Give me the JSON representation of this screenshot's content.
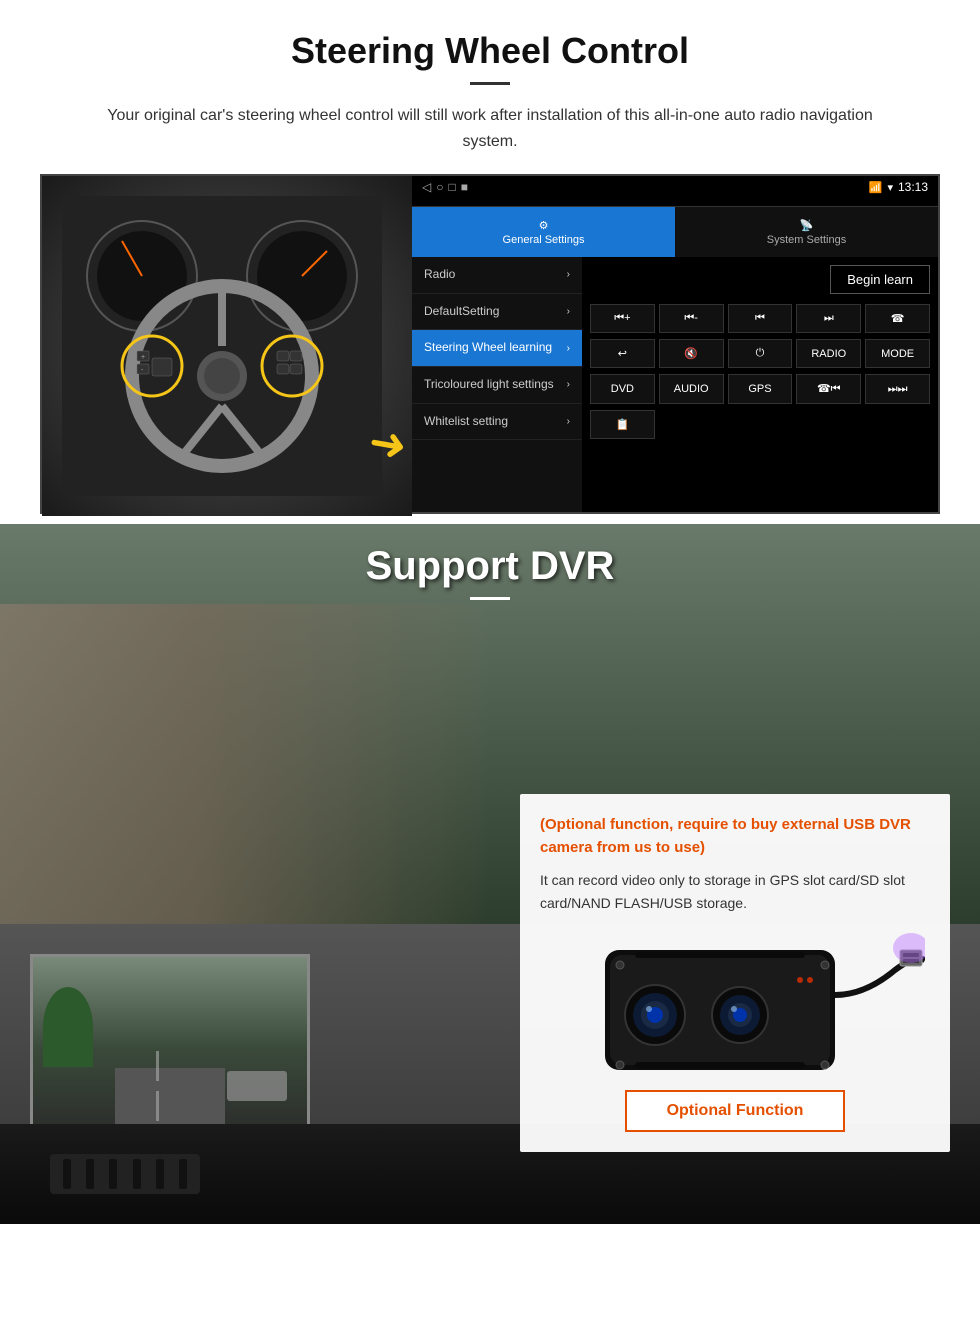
{
  "page": {
    "steering_section": {
      "title": "Steering Wheel Control",
      "description": "Your original car's steering wheel control will still work after installation of this all-in-one auto radio navigation system.",
      "android_ui": {
        "status_bar": {
          "time": "13:13",
          "icons": [
            "signal",
            "wifi",
            "battery"
          ]
        },
        "nav_buttons": [
          "◁",
          "○",
          "□",
          "■"
        ],
        "tabs": [
          {
            "id": "general",
            "label": "General Settings",
            "active": true
          },
          {
            "id": "system",
            "label": "System Settings",
            "active": false
          }
        ],
        "menu_items": [
          {
            "label": "Radio",
            "active": false
          },
          {
            "label": "DefaultSetting",
            "active": false
          },
          {
            "label": "Steering Wheel learning",
            "active": true
          },
          {
            "label": "Tricoloured light settings",
            "active": false
          },
          {
            "label": "Whitelist setting",
            "active": false
          }
        ],
        "begin_learn_button": "Begin learn",
        "control_buttons_row1": [
          "⏮+",
          "⏮-",
          "⏮",
          "⏭",
          "📞"
        ],
        "control_buttons_row2": [
          "↩",
          "🔇x",
          "⏻",
          "RADIO",
          "MODE"
        ],
        "control_buttons_row3": [
          "DVD",
          "AUDIO",
          "GPS",
          "📞⏮",
          "⏭⏭"
        ],
        "control_buttons_row4": [
          "📋"
        ]
      }
    },
    "dvr_section": {
      "title": "Support DVR",
      "optional_text": "(Optional function, require to buy external USB DVR camera from us to use)",
      "description": "It can record video only to storage in GPS slot card/SD slot card/NAND FLASH/USB storage.",
      "optional_button_label": "Optional Function"
    }
  }
}
